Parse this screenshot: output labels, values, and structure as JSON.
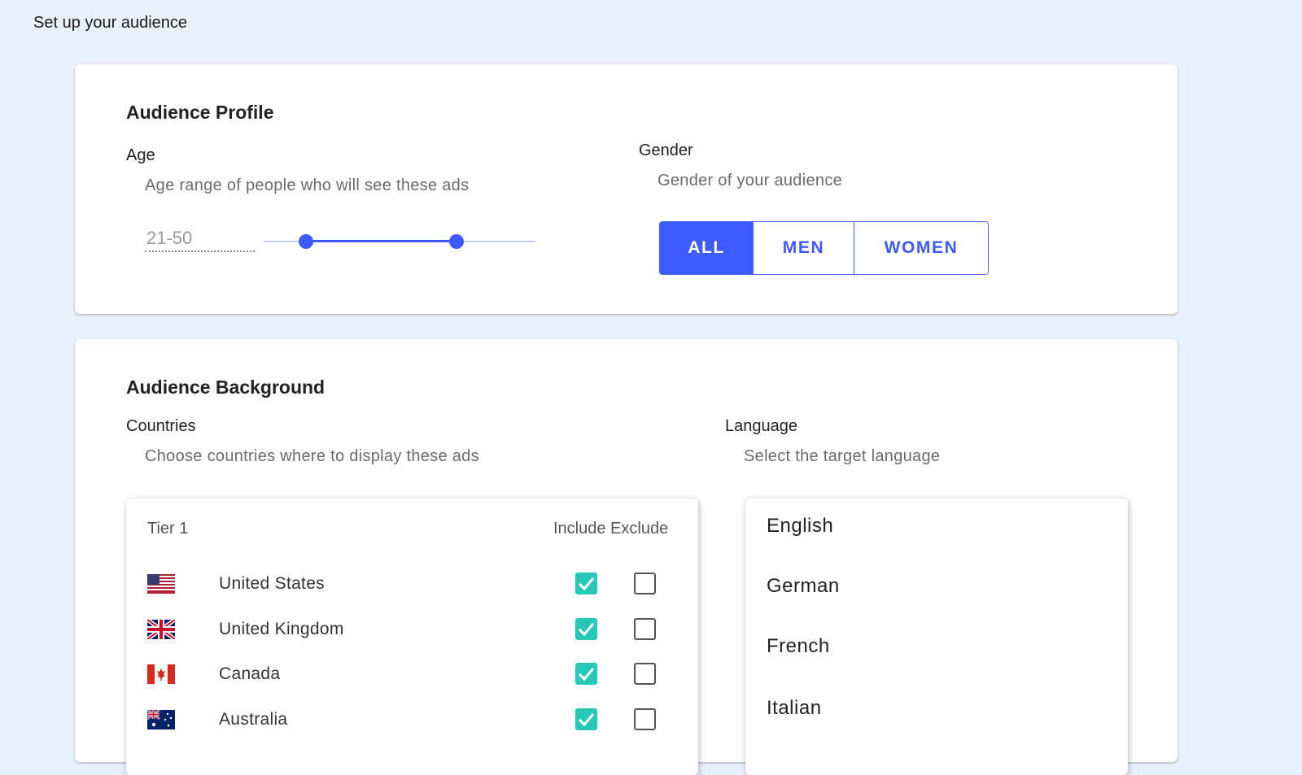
{
  "page": {
    "title": "Set up your audience"
  },
  "profile": {
    "title": "Audience Profile",
    "age": {
      "label": "Age",
      "description": "Age range of people who will see these ads",
      "range_value": "21-50",
      "slider_min_fraction": 0.156,
      "slider_max_fraction": 0.71
    },
    "gender": {
      "label": "Gender",
      "description": "Gender of your audience",
      "options": [
        "ALL",
        "MEN",
        "WOMEN"
      ],
      "selected": "ALL",
      "accent_color": "#3d5afe"
    }
  },
  "background": {
    "title": "Audience Background",
    "countries": {
      "label": "Countries",
      "description": "Choose countries where to display these ads",
      "tier_label": "Tier 1",
      "include_exclude_label": "Include Exclude",
      "rows": [
        {
          "name": "United States",
          "flag": "us-flag-icon",
          "include": true,
          "exclude": false
        },
        {
          "name": "United Kingdom",
          "flag": "uk-flag-icon",
          "include": true,
          "exclude": false
        },
        {
          "name": "Canada",
          "flag": "canada-flag-icon",
          "include": true,
          "exclude": false
        },
        {
          "name": "Australia",
          "flag": "australia-flag-icon",
          "include": true,
          "exclude": false
        }
      ],
      "include_color": "#25c9b5"
    },
    "language": {
      "label": "Language",
      "description": "Select the target language",
      "options": [
        "English",
        "German",
        "French",
        "Italian"
      ]
    }
  }
}
